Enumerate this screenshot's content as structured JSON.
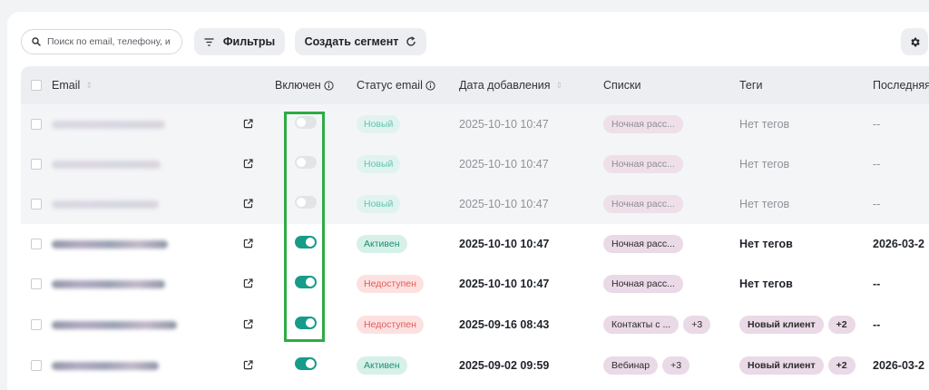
{
  "toolbar": {
    "search_placeholder": "Поиск по email, телефону, и",
    "filters_label": "Фильтры",
    "create_segment_label": "Создать сегмент"
  },
  "columns": {
    "email": "Email",
    "enabled": "Включен",
    "email_status": "Статус email",
    "date_added": "Дата добавления",
    "lists": "Списки",
    "tags": "Теги",
    "last": "Последняя"
  },
  "colors": {
    "toggle_on": "#179c89",
    "toggle_off": "#e2e4e8",
    "badge_new_bg": "#dbf3ee",
    "badge_new_fg": "#35b39a",
    "badge_active_bg": "#d6f1e8",
    "badge_active_fg": "#1c8e73",
    "badge_unavail_bg": "#fde1e1",
    "badge_unavail_fg": "#e25a5a",
    "tag_bg": "#ead9e6",
    "highlight": "#2eab45"
  },
  "rows": [
    {
      "enabled": false,
      "status": "Новый",
      "status_kind": "new",
      "date": "2025-10-10 10:47",
      "list": "Ночная расс...",
      "list_more": "",
      "tag": "Нет тегов",
      "tag_is_chip": false,
      "tag_more": "",
      "last": "--"
    },
    {
      "enabled": false,
      "status": "Новый",
      "status_kind": "new",
      "date": "2025-10-10 10:47",
      "list": "Ночная расс...",
      "list_more": "",
      "tag": "Нет тегов",
      "tag_is_chip": false,
      "tag_more": "",
      "last": "--"
    },
    {
      "enabled": false,
      "status": "Новый",
      "status_kind": "new",
      "date": "2025-10-10 10:47",
      "list": "Ночная расс...",
      "list_more": "",
      "tag": "Нет тегов",
      "tag_is_chip": false,
      "tag_more": "",
      "last": "--"
    },
    {
      "enabled": true,
      "status": "Активен",
      "status_kind": "active",
      "date": "2025-10-10 10:47",
      "list": "Ночная расс...",
      "list_more": "",
      "tag": "Нет тегов",
      "tag_is_chip": false,
      "tag_more": "",
      "last": "2026-03-2"
    },
    {
      "enabled": true,
      "status": "Недоступен",
      "status_kind": "unavailable",
      "date": "2025-10-10 10:47",
      "list": "Ночная расс...",
      "list_more": "",
      "tag": "Нет тегов",
      "tag_is_chip": false,
      "tag_more": "",
      "last": "--"
    },
    {
      "enabled": true,
      "status": "Недоступен",
      "status_kind": "unavailable",
      "date": "2025-09-16 08:43",
      "list": "Контакты с ...",
      "list_more": "+3",
      "tag": "Новый клиент",
      "tag_is_chip": true,
      "tag_more": "+2",
      "last": "--"
    },
    {
      "enabled": true,
      "status": "Активен",
      "status_kind": "active",
      "date": "2025-09-02 09:59",
      "list": "Вебинар",
      "list_more": "+3",
      "tag": "Новый клиент",
      "tag_is_chip": true,
      "tag_more": "+2",
      "last": "2026-03-2"
    }
  ]
}
